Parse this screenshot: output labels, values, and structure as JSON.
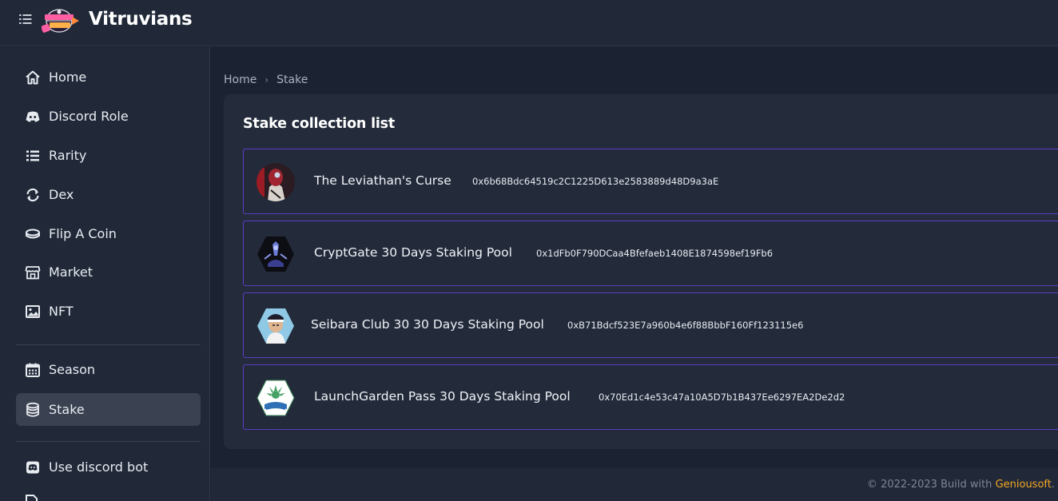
{
  "header": {
    "app_title": "Vitruvians",
    "menu_icon": "menu-list-icon",
    "logo": "vitruvians-logo"
  },
  "sidebar": {
    "items": [
      {
        "label": "Home",
        "icon": "home-icon"
      },
      {
        "label": "Discord Role",
        "icon": "discord-icon"
      },
      {
        "label": "Rarity",
        "icon": "list-icon"
      },
      {
        "label": "Dex",
        "icon": "sync-icon"
      },
      {
        "label": "Flip A Coin",
        "icon": "coin-icon"
      },
      {
        "label": "Market",
        "icon": "store-icon"
      },
      {
        "label": "NFT",
        "icon": "image-icon"
      }
    ],
    "items2": [
      {
        "label": "Season",
        "icon": "calendar-icon"
      },
      {
        "label": "Stake",
        "icon": "database-icon",
        "active": true
      }
    ],
    "items3": [
      {
        "label": "Use discord bot",
        "icon": "discord-icon"
      }
    ]
  },
  "breadcrumb": {
    "home": "Home",
    "current": "Stake"
  },
  "panel": {
    "title": "Stake collection list",
    "collections": [
      {
        "name": "The Leviathan's Curse",
        "address": "0x6b68Bdc64519c2C1225D613e2583889d48D9a3aE"
      },
      {
        "name": "CryptGate 30 Days Staking Pool",
        "address": "0x1dFb0F790DCaa4Bfefaeb1408E1874598ef19Fb6"
      },
      {
        "name": "Seibara Club 30 30 Days Staking Pool",
        "address": "0xB71Bdcf523E7a960b4e6f88BbbF160Ff123115e6"
      },
      {
        "name": "LaunchGarden Pass 30 Days Staking Pool",
        "address": "0x70Ed1c4e53c47a10A5D7b1B437Ee6297EA2De2d2"
      }
    ]
  },
  "footer": {
    "text": "© 2022-2023 Build with ",
    "link": "Geniousoft",
    "suffix": "."
  },
  "colors": {
    "background": "#1b2231",
    "panel": "#242c3b",
    "row_border": "#5b3cc4",
    "accent_link": "#f5a623",
    "active_item": "#3a4150"
  }
}
